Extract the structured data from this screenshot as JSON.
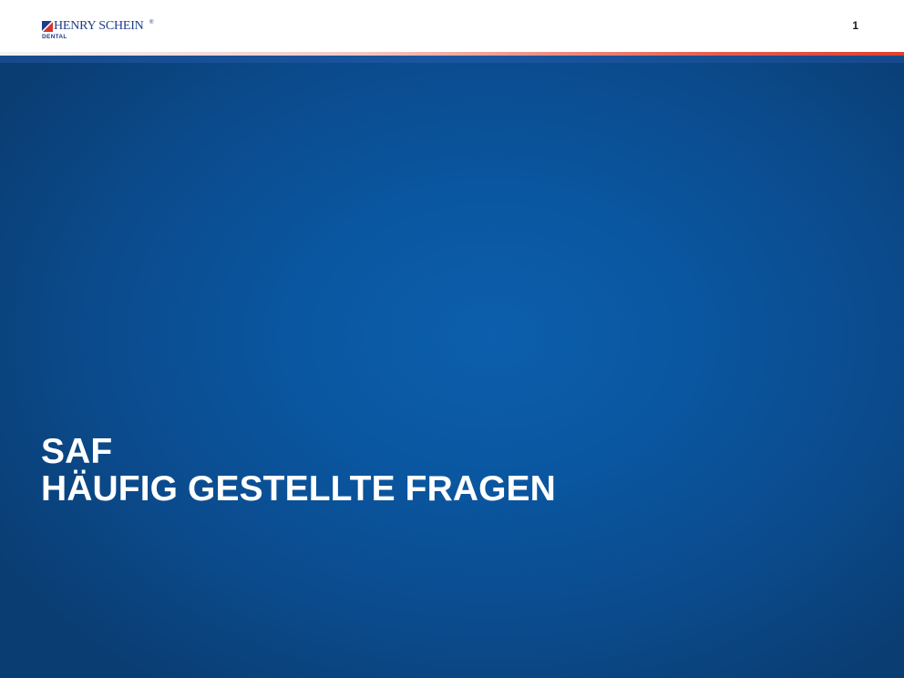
{
  "header": {
    "logo": {
      "name": "HENRY SCHEIN",
      "registered": "®",
      "subtitle": "DENTAL",
      "mark_colors": {
        "blue": "#1d3d8a",
        "red": "#d9342b"
      }
    },
    "page_number": "1"
  },
  "colors": {
    "background_center": "#0c5fac",
    "background_edge": "#0a3d72",
    "accent_red": "#df3f2f",
    "title_text": "#ffffff"
  },
  "title": {
    "line1": "SAF",
    "line2": "HÄUFIG GESTELLTE FRAGEN"
  }
}
